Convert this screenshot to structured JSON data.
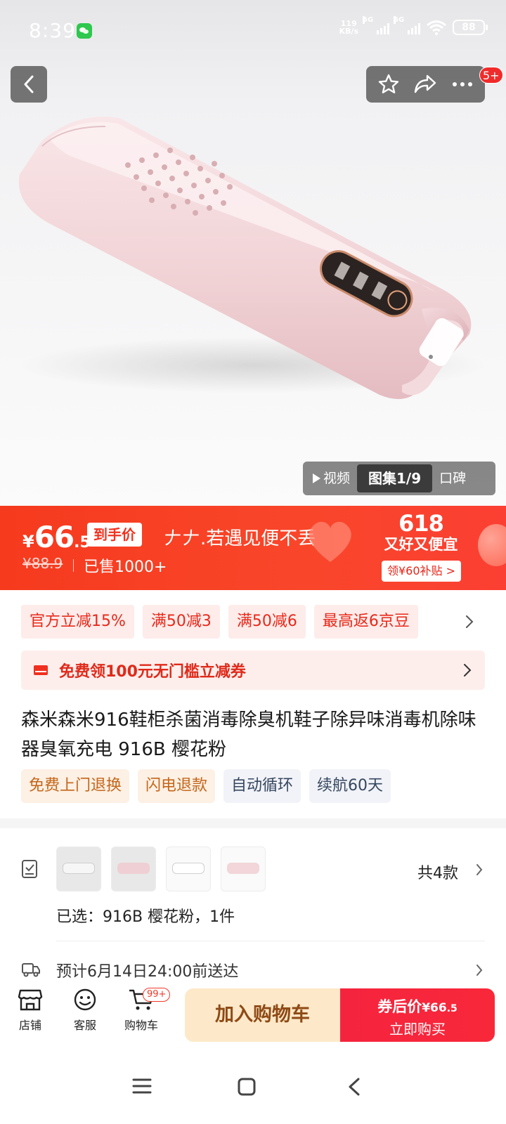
{
  "status_bar": {
    "time": "8:39",
    "net_speed_value": "119",
    "net_speed_unit": "KB/s",
    "sim1_label": "5G",
    "sim2_label": "5G",
    "battery": "88"
  },
  "top_actions": {
    "more_badge": "5+"
  },
  "media_tabs": [
    {
      "label": "视频"
    },
    {
      "label": "图集1/9"
    },
    {
      "label": "口碑"
    }
  ],
  "price": {
    "symbol": "¥",
    "integer": "66",
    "decimal": ".5",
    "tag": "到手价",
    "slogan": "𠂇𠂇.若遇见便不丢",
    "original": "¥88.9",
    "sold": "已售1000+",
    "promo_title": "618",
    "promo_sub": "又好又便宜",
    "subsidy": "领¥60补贴 >"
  },
  "coupons": [
    "官方立减15%",
    "满50减3",
    "满50减6",
    "最高返6京豆"
  ],
  "free_coupon": "免费领100元无门槛立减券",
  "title": "森米森米916鞋柜杀菌消毒除臭机鞋子除异味消毒机除味器臭氧充电 916B 樱花粉",
  "services": [
    "免费上门退换",
    "闪电退款",
    "自动循环",
    "续航60天"
  ],
  "spec": {
    "variant_count": "共4款",
    "selected": "已选：916B 樱花粉，1件"
  },
  "delivery": "预计6月14日24:00前送达",
  "bottom_nav": {
    "store": "店铺",
    "service": "客服",
    "cart": "购物车",
    "cart_badge": "99+"
  },
  "buttons": {
    "add_to_cart": "加入购物车",
    "coupon_price_label": "券后价",
    "coupon_price_symbol": "¥",
    "coupon_price_int": "66",
    "coupon_price_dec": ".5",
    "buy_now": "立即购买"
  },
  "colors": {
    "brand_red": "#f63a1e",
    "coupon_text": "#e8291b",
    "add_cart_bg": "#fde9c9",
    "buy_now_bg": "#f5243e"
  },
  "icons": [
    "back-icon",
    "star-icon",
    "share-icon",
    "more-icon",
    "play-icon",
    "ticket-icon",
    "chevron-right-icon",
    "spec-icon",
    "truck-icon",
    "store-icon",
    "service-icon",
    "cart-icon",
    "menu-icon",
    "home-icon",
    "back-nav-icon"
  ]
}
